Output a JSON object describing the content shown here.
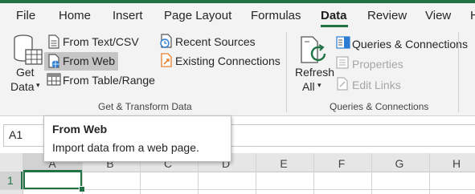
{
  "ribbon_tabs": [
    {
      "label": "File"
    },
    {
      "label": "Home"
    },
    {
      "label": "Insert"
    },
    {
      "label": "Page Layout"
    },
    {
      "label": "Formulas"
    },
    {
      "label": "Data",
      "active": true
    },
    {
      "label": "Review"
    },
    {
      "label": "View"
    },
    {
      "label": "H"
    }
  ],
  "get_transform": {
    "get_data_line1": "Get",
    "get_data_line2": "Data",
    "from_text_csv": "From Text/CSV",
    "from_web": "From Web",
    "from_table_range": "From Table/Range",
    "recent_sources": "Recent Sources",
    "existing_connections": "Existing Connections",
    "group_label": "Get & Transform Data"
  },
  "queries": {
    "refresh_line1": "Refresh",
    "refresh_line2": "All",
    "queries_connections": "Queries & Connections",
    "properties": "Properties",
    "edit_links": "Edit Links",
    "group_label": "Queries & Connections"
  },
  "name_box": "A1",
  "columns": [
    "A",
    "B",
    "C",
    "D",
    "E",
    "F",
    "G",
    "H"
  ],
  "rows": [
    "1"
  ],
  "tooltip": {
    "title": "From Web",
    "description": "Import data from a web page."
  },
  "icons": {
    "get_data": "database-icon",
    "from_text_csv": "text-file-icon",
    "from_web": "web-page-icon",
    "from_table_range": "table-icon",
    "recent_sources": "recent-sources-icon",
    "existing_connections": "existing-connections-icon",
    "refresh_all": "refresh-icon",
    "queries_connections": "queries-pane-icon",
    "properties": "properties-icon",
    "edit_links": "edit-links-icon"
  },
  "colors": {
    "accent": "#217346",
    "ribbon_bg": "#f3f3f3",
    "hover": "#c5c5c5",
    "web_icon_blue": "#2b7cd3",
    "connection_orange": "#e8812d"
  }
}
